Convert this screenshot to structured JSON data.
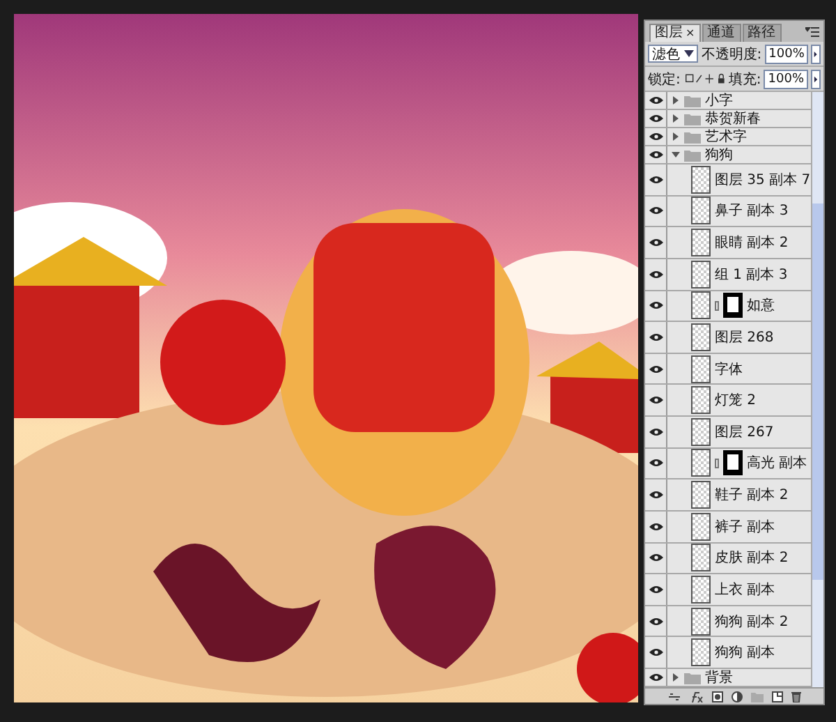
{
  "panel": {
    "tabs": [
      {
        "label": "图层",
        "selected": true,
        "close": "×"
      },
      {
        "label": "通道",
        "selected": false
      },
      {
        "label": "路径",
        "selected": false
      }
    ],
    "blend_mode": "滤色",
    "opacity_label": "不透明度:",
    "opacity": "100%",
    "lock_label": "锁定:",
    "fill_label": "填充:",
    "fill": "100%"
  },
  "layers": [
    {
      "kind": "group",
      "name": "小字",
      "visible": true,
      "expanded": false
    },
    {
      "kind": "group",
      "name": "恭贺新春",
      "visible": true,
      "expanded": false
    },
    {
      "kind": "group",
      "name": "艺术字",
      "visible": true,
      "expanded": false
    },
    {
      "kind": "group",
      "name": "狗狗",
      "visible": true,
      "expanded": true,
      "children": [
        {
          "kind": "layer",
          "name": "图层 35 副本 7",
          "visible": true
        },
        {
          "kind": "layer",
          "name": "鼻子 副本 3",
          "visible": true
        },
        {
          "kind": "layer",
          "name": "眼睛 副本 2",
          "visible": true
        },
        {
          "kind": "layer",
          "name": "组 1 副本 3",
          "visible": true
        },
        {
          "kind": "masked",
          "name": "如意",
          "visible": true
        },
        {
          "kind": "layer",
          "name": "图层 268",
          "visible": true
        },
        {
          "kind": "layer",
          "name": "字体",
          "visible": true
        },
        {
          "kind": "layer",
          "name": "灯笼 2",
          "visible": true
        },
        {
          "kind": "layer",
          "name": "图层 267",
          "visible": true
        },
        {
          "kind": "masked",
          "name": "高光 副本",
          "visible": true
        },
        {
          "kind": "layer",
          "name": "鞋子 副本 2",
          "visible": true
        },
        {
          "kind": "layer",
          "name": "裤子 副本",
          "visible": true
        },
        {
          "kind": "layer",
          "name": "皮肤 副本 2",
          "visible": true
        },
        {
          "kind": "layer",
          "name": "上衣 副本",
          "visible": true
        },
        {
          "kind": "layer",
          "name": "狗狗 副本 2",
          "visible": true
        },
        {
          "kind": "layer",
          "name": "狗狗 副本",
          "visible": true
        }
      ]
    },
    {
      "kind": "group",
      "name": "背景",
      "visible": true,
      "expanded": false
    }
  ]
}
